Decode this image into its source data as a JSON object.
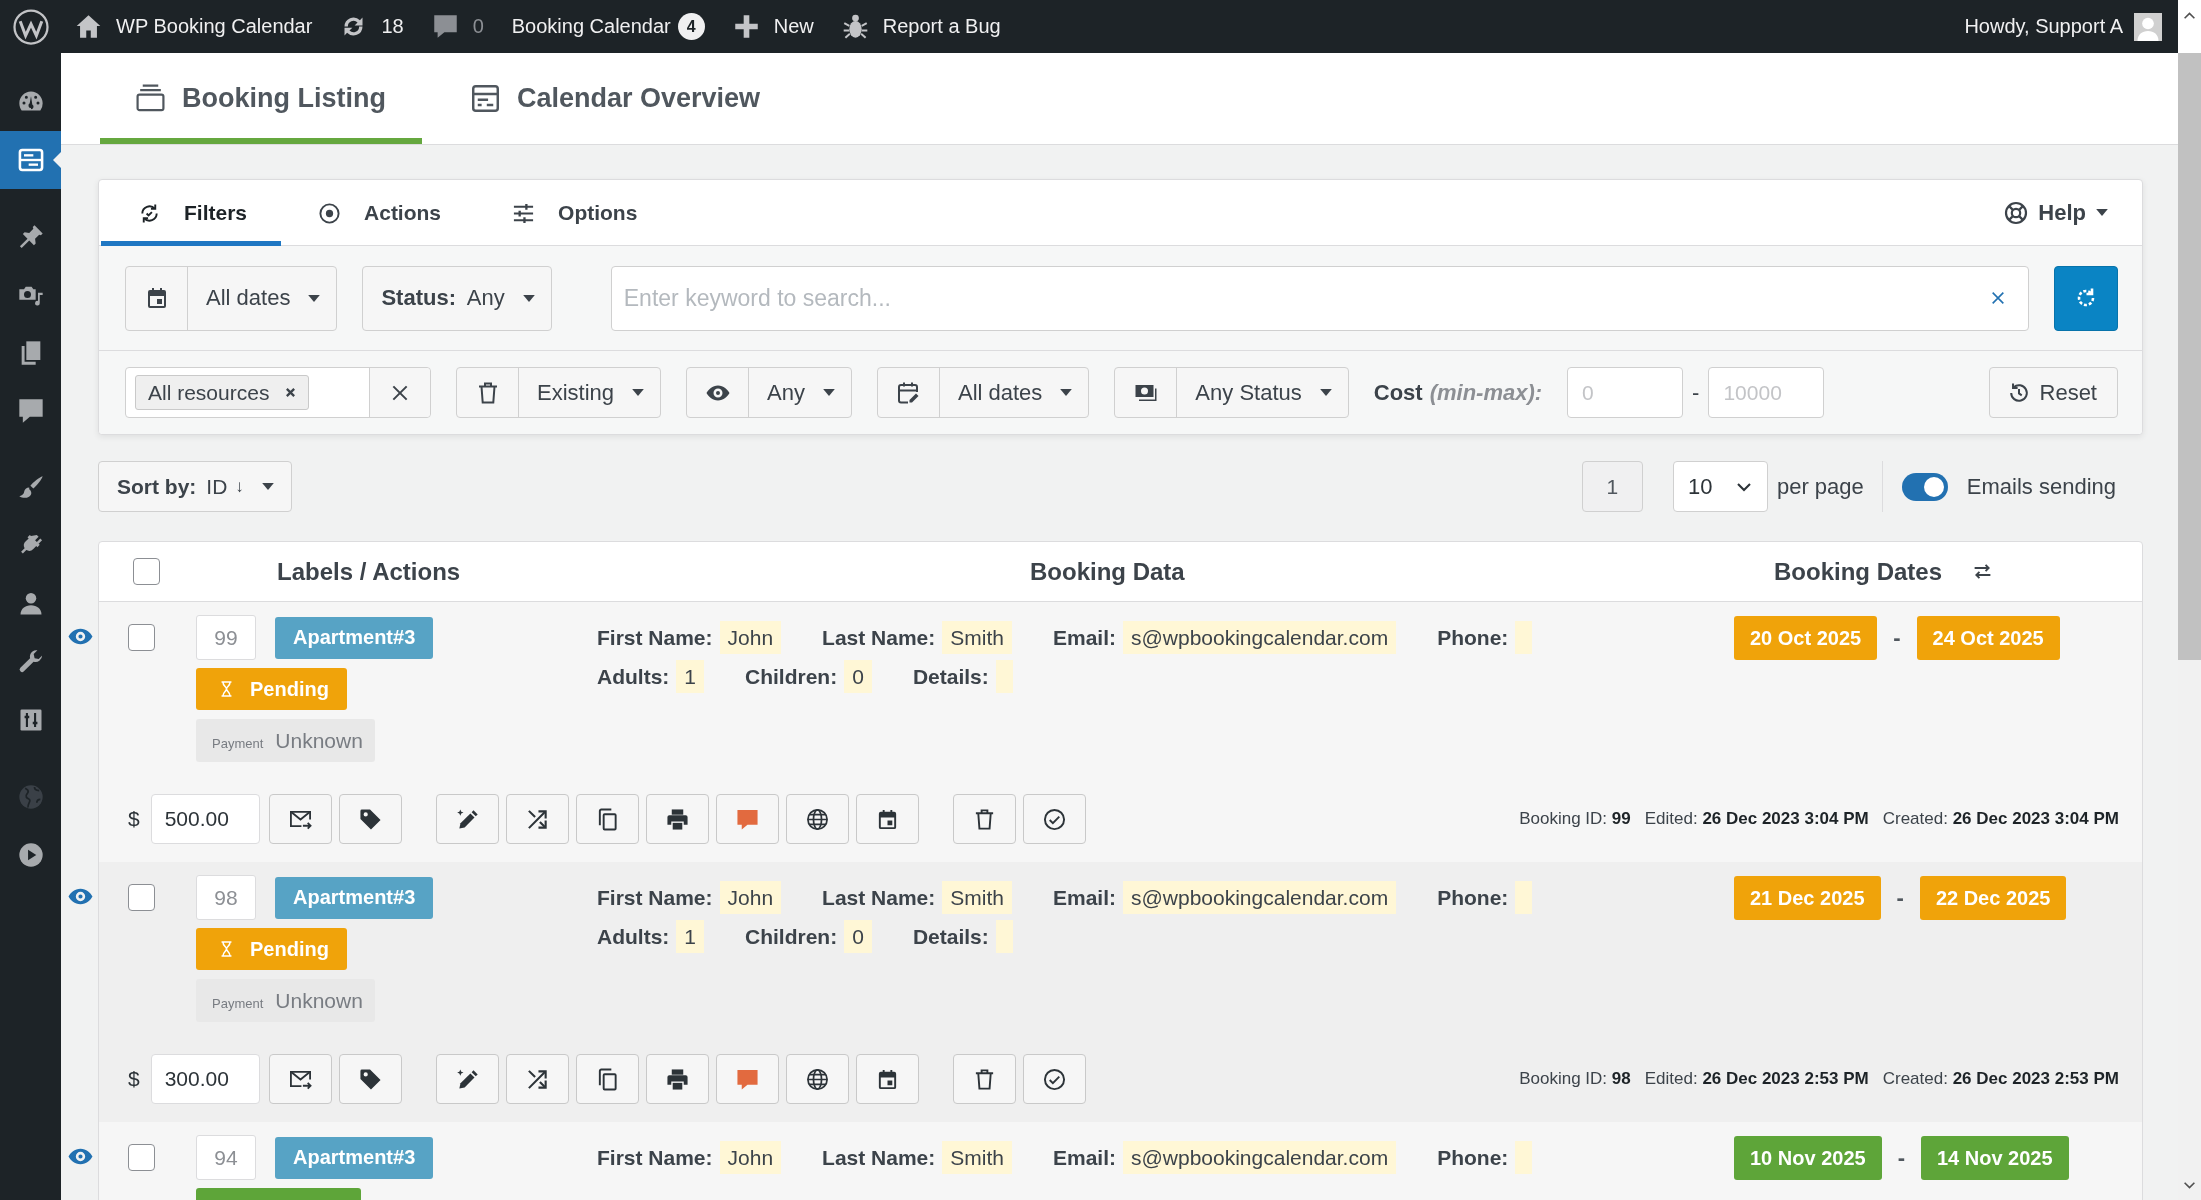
{
  "admin_bar": {
    "site": "WP Booking Calendar",
    "updates": "18",
    "comments": "0",
    "plugin": "Booking Calendar",
    "plugin_badge": "4",
    "new": "New",
    "report": "Report a Bug",
    "greeting": "Howdy, Support A"
  },
  "sidebar": {
    "groups": [
      {
        "items": [
          {
            "selected": false,
            "disabled": false
          },
          {
            "selected": true,
            "disabled": false
          }
        ]
      },
      {
        "items": [
          {
            "selected": false,
            "disabled": false
          },
          {
            "selected": false,
            "disabled": false
          },
          {
            "selected": false,
            "disabled": false
          },
          {
            "selected": false,
            "disabled": false
          }
        ]
      },
      {
        "items": [
          {
            "selected": false,
            "disabled": false
          },
          {
            "selected": false,
            "disabled": false
          },
          {
            "selected": false,
            "disabled": false
          },
          {
            "selected": false,
            "disabled": false
          },
          {
            "selected": false,
            "disabled": false
          }
        ]
      },
      {
        "items": [
          {
            "selected": false,
            "disabled": true
          },
          {
            "selected": false,
            "disabled": false
          }
        ]
      }
    ]
  },
  "page_tabs": [
    {
      "label": "Booking Listing",
      "selected": true
    },
    {
      "label": "Calendar Overview",
      "selected": false
    }
  ],
  "filter_panel": {
    "tabs": [
      {
        "label": "Filters",
        "selected": true
      },
      {
        "label": "Actions",
        "selected": false
      },
      {
        "label": "Options",
        "selected": false
      }
    ],
    "help": "Help",
    "dates": "All dates",
    "status": {
      "label": "Status:",
      "value": "Any"
    },
    "search": {
      "placeholder": "Enter keyword to search..."
    },
    "resources": {
      "tags": [
        "All resources"
      ]
    },
    "existing": "Existing",
    "visibility": "Any",
    "booking_dates": "All dates",
    "payment_status": "Any Status",
    "cost": {
      "label": "Cost",
      "hint": "(min-max):",
      "min": {
        "placeholder": "0"
      },
      "separator": "-",
      "max": {
        "placeholder": "10000"
      }
    },
    "reset": "Reset"
  },
  "sort": {
    "label": "Sort by:",
    "value": "ID",
    "arrow": "↓"
  },
  "pagination": {
    "page": "1",
    "per_page": "10",
    "per_page_label": "per page"
  },
  "emails": {
    "label": "Emails sending",
    "on": true
  },
  "table": {
    "select_all": {
      "checked": false
    },
    "columns": [
      "Labels / Actions",
      "Booking Data",
      "Booking Dates"
    ],
    "rows": [
      {
        "new": true,
        "selected": false,
        "id": "99",
        "resource": "Apartment#3",
        "color": "#f0a30a",
        "status": "Pending",
        "payment": {
          "label": "Payment",
          "value": "Unknown"
        },
        "lines": [
          {
            "fields": [
              {
                "label": "First Name:",
                "value": "John"
              },
              {
                "label": "Last Name:",
                "value": "Smith"
              },
              {
                "label": "Email:",
                "value": "s@wpbookingcalendar.com"
              },
              {
                "label": "Phone:"
              }
            ]
          },
          {
            "fields": [
              {
                "label": "Adults:",
                "value": "1"
              },
              {
                "label": "Children:",
                "value": "0"
              },
              {
                "label": "Details:"
              }
            ]
          }
        ],
        "dates": [
          "20 Oct 2025",
          "24 Oct 2025"
        ],
        "date_separator": "-",
        "currency": "$",
        "cost": "500.00",
        "has_note": true,
        "meta": [
          "Booking ID: **99**",
          "Edited: **26 Dec 2023 3:04 PM**",
          "Created: **26 Dec 2023 3:04 PM**"
        ]
      },
      {
        "new": true,
        "selected": false,
        "id": "98",
        "resource": "Apartment#3",
        "color": "#f0a30a",
        "status": "Pending",
        "payment": {
          "label": "Payment",
          "value": "Unknown"
        },
        "lines": [
          {
            "fields": [
              {
                "label": "First Name:",
                "value": "John"
              },
              {
                "label": "Last Name:",
                "value": "Smith"
              },
              {
                "label": "Email:",
                "value": "s@wpbookingcalendar.com"
              },
              {
                "label": "Phone:"
              }
            ]
          },
          {
            "fields": [
              {
                "label": "Adults:",
                "value": "1"
              },
              {
                "label": "Children:",
                "value": "0"
              },
              {
                "label": "Details:"
              }
            ]
          }
        ],
        "dates": [
          "21 Dec 2025",
          "22 Dec 2025"
        ],
        "date_separator": "-",
        "currency": "$",
        "cost": "300.00",
        "has_note": true,
        "meta": [
          "Booking ID: **98**",
          "Edited: **26 Dec 2023 2:53 PM**",
          "Created: **26 Dec 2023 2:53 PM**"
        ]
      },
      {
        "new": true,
        "selected": false,
        "id": "94",
        "resource": "Apartment#3",
        "color": "#5ea539",
        "lines": [
          {
            "fields": [
              {
                "label": "First Name:",
                "value": "John"
              },
              {
                "label": "Last Name:",
                "value": "Smith"
              },
              {
                "label": "Email:",
                "value": "s@wpbookingcalendar.com"
              },
              {
                "label": "Phone:"
              }
            ]
          }
        ],
        "dates": [
          "10 Nov 2025",
          "14 Nov 2025"
        ],
        "date_separator": "-"
      }
    ]
  }
}
